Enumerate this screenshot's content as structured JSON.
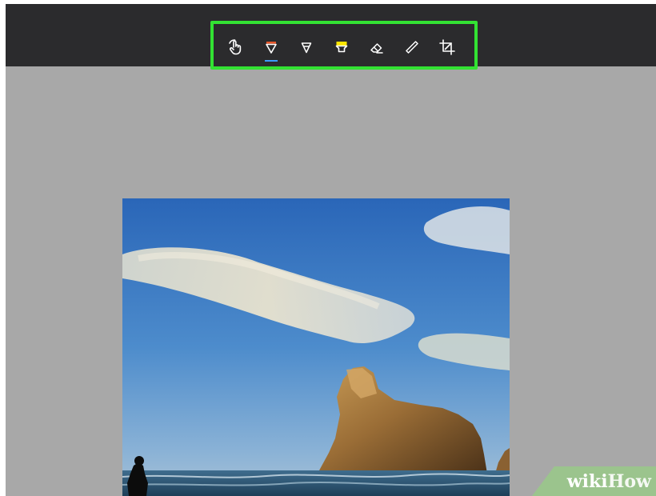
{
  "toolbar": {
    "tools": [
      {
        "name": "touch-writing",
        "icon": "hand-touch-icon"
      },
      {
        "name": "ballpoint-pen",
        "icon": "pen-icon",
        "accent": "#e8562a"
      },
      {
        "name": "pencil",
        "icon": "pencil-icon"
      },
      {
        "name": "highlighter",
        "icon": "highlighter-icon",
        "accent": "#ffe600"
      },
      {
        "name": "eraser",
        "icon": "eraser-icon"
      },
      {
        "name": "ruler",
        "icon": "ruler-icon"
      },
      {
        "name": "crop",
        "icon": "crop-icon"
      }
    ],
    "highlight_color": "#33e233"
  },
  "watermark": {
    "part1": "wiki",
    "part2": "How"
  }
}
